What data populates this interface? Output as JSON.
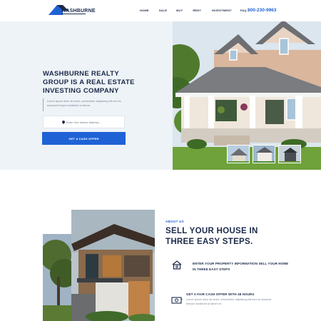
{
  "header": {
    "brand": "WASHBURNE",
    "nav": [
      "HOME",
      "SALE",
      "BUY",
      "RENT",
      "INVESTMENT",
      "FAQ"
    ],
    "phone": "800-230-9963"
  },
  "hero": {
    "title": "WASHBURNE REALTY GROUP IS A REAL ESTATE INVESTING COMPANY",
    "description": "Lorem ipsum dolor sit amet, consectetur adipiscing elit sed do eiusmod tempor incididunt ut labore.",
    "address_placeholder": "Enter Your Interior Address....",
    "cta_label": "GET A CASH OFFER"
  },
  "steps_section": {
    "eyebrow": "ABOUT US",
    "title": "SELL YOUR HOUSE IN THREE EASY STEPS.",
    "steps": [
      {
        "title": "ENTER YOUR PROPERTY INFORMATION SELL YOUR HOME IN THREE EASY STEPS",
        "icon": "house-key-icon"
      },
      {
        "title": "GET A FAIR CASH OFFER WITH 48 HOURS",
        "description": "Lorem ipsum dolor sit amet, consectetur adipiscing elit sed do eiusmod tempor incididunt ut labore et.",
        "icon": "cash-icon"
      }
    ]
  },
  "colors": {
    "accent": "#1f62d6",
    "navy": "#1b2a4a",
    "hero_bg": "#eef3f7"
  }
}
